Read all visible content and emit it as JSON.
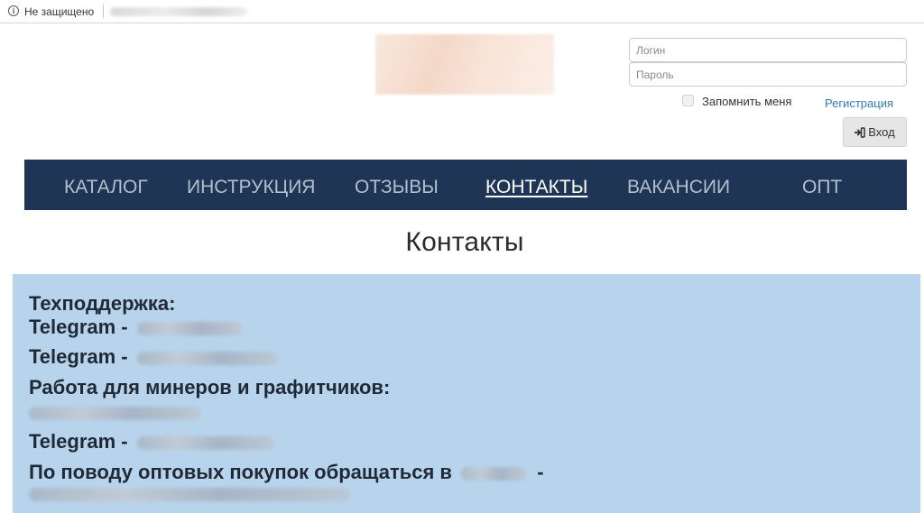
{
  "browser": {
    "security_label": "Не защищено",
    "info_icon": "info-circle-icon"
  },
  "auth": {
    "login_placeholder": "Логин",
    "password_placeholder": "Пароль",
    "remember_label": "Запомнить меня",
    "register_label": "Регистрация",
    "login_button_label": "Вход",
    "login_icon": "sign-in-icon"
  },
  "nav": {
    "items": [
      {
        "label": "КАТАЛОГ"
      },
      {
        "label": "ИНСТРУКЦИЯ"
      },
      {
        "label": "ОТЗЫВЫ"
      },
      {
        "label": "КОНТАКТЫ"
      },
      {
        "label": "ВАКАНСИИ"
      },
      {
        "label": "ОПТ"
      }
    ],
    "active_label": "КОНТАКТЫ"
  },
  "page": {
    "title": "Контакты"
  },
  "contacts": {
    "support_heading": "Техподдержка:",
    "telegram_1_label": "Telegram -",
    "telegram_2_label": "Telegram -",
    "miners_heading": "Работа для минеров и графитчиков:",
    "telegram_3_label": "Telegram -",
    "wholesale_text": "По поводу оптовых покупок обращаться в",
    "wholesale_dash": "-"
  },
  "colors": {
    "nav_background": "#1e3555",
    "panel_background": "#b8d4ec",
    "link": "#337ab7"
  }
}
